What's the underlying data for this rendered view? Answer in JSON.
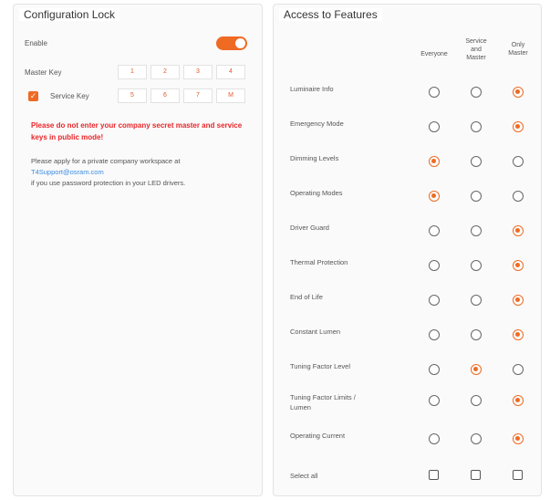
{
  "config": {
    "title": "Configuration Lock",
    "enable_label": "Enable",
    "enable_on": true,
    "master_key_label": "Master Key",
    "master_key": [
      "1",
      "2",
      "3",
      "4"
    ],
    "service_key_label": "Service Key",
    "service_key_checked": true,
    "service_key": [
      "5",
      "6",
      "7",
      "M"
    ],
    "warning": "Please do not enter your company secret master and service keys in public mode!",
    "info_line1": "Please apply for a private company workspace at",
    "info_link": "T4Support@osram.com",
    "info_line2": "if you use password protection in your LED drivers.",
    "accent_color": "#ef6a22",
    "warning_color": "#e8262a"
  },
  "access": {
    "title": "Access to Features",
    "columns": [
      "Everyone",
      "Service and Master",
      "Only Master"
    ],
    "features": [
      {
        "label": "Luminaire Info",
        "selected": 2
      },
      {
        "label": "Emergency Mode",
        "selected": 2
      },
      {
        "label": "Dimming Levels",
        "selected": 0
      },
      {
        "label": "Operating Modes",
        "selected": 0
      },
      {
        "label": "Driver Guard",
        "selected": 2
      },
      {
        "label": "Thermal Protection",
        "selected": 2
      },
      {
        "label": "End of Life",
        "selected": 2
      },
      {
        "label": "Constant Lumen",
        "selected": 2
      },
      {
        "label": "Tuning Factor Level",
        "selected": 1
      },
      {
        "label": "Tuning Factor Limits / Lumen",
        "selected": 2
      },
      {
        "label": "Operating Current",
        "selected": 2
      }
    ],
    "select_all_label": "Select all"
  }
}
